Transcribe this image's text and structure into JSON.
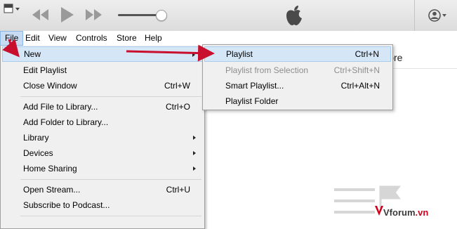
{
  "menubar": {
    "items": [
      "File",
      "Edit",
      "View",
      "Controls",
      "Store",
      "Help"
    ]
  },
  "store_tab": {
    "label": "Store"
  },
  "file_menu": {
    "items": [
      {
        "label": "New",
        "shortcut": "",
        "submenu": true,
        "highlighted": true
      },
      {
        "label": "Edit Playlist",
        "shortcut": "",
        "submenu": false
      },
      {
        "label": "Close Window",
        "shortcut": "Ctrl+W",
        "submenu": false
      },
      {
        "label": "Add File to Library...",
        "shortcut": "Ctrl+O",
        "submenu": false
      },
      {
        "label": "Add Folder to Library...",
        "shortcut": "",
        "submenu": false
      },
      {
        "label": "Library",
        "shortcut": "",
        "submenu": true
      },
      {
        "label": "Devices",
        "shortcut": "",
        "submenu": true
      },
      {
        "label": "Home Sharing",
        "shortcut": "",
        "submenu": true
      },
      {
        "label": "Open Stream...",
        "shortcut": "Ctrl+U",
        "submenu": false
      },
      {
        "label": "Subscribe to Podcast...",
        "shortcut": "",
        "submenu": false
      }
    ]
  },
  "new_submenu": {
    "items": [
      {
        "label": "Playlist",
        "shortcut": "Ctrl+N",
        "enabled": true,
        "highlighted": true
      },
      {
        "label": "Playlist from Selection",
        "shortcut": "Ctrl+Shift+N",
        "enabled": false
      },
      {
        "label": "Smart Playlist...",
        "shortcut": "Ctrl+Alt+N",
        "enabled": true
      },
      {
        "label": "Playlist Folder",
        "shortcut": "",
        "enabled": true
      }
    ]
  },
  "toolbar": {
    "icons": [
      "app-menu-icon",
      "previous-icon",
      "play-icon",
      "next-icon",
      "volume-slider",
      "apple-logo-icon",
      "account-icon"
    ]
  },
  "watermark": {
    "brand": "Vforum",
    "suffix": ".vn"
  },
  "colors": {
    "highlight_bg": "#d5e6f7",
    "arrow": "#c8102e",
    "disabled_text": "#8d8d8d"
  }
}
